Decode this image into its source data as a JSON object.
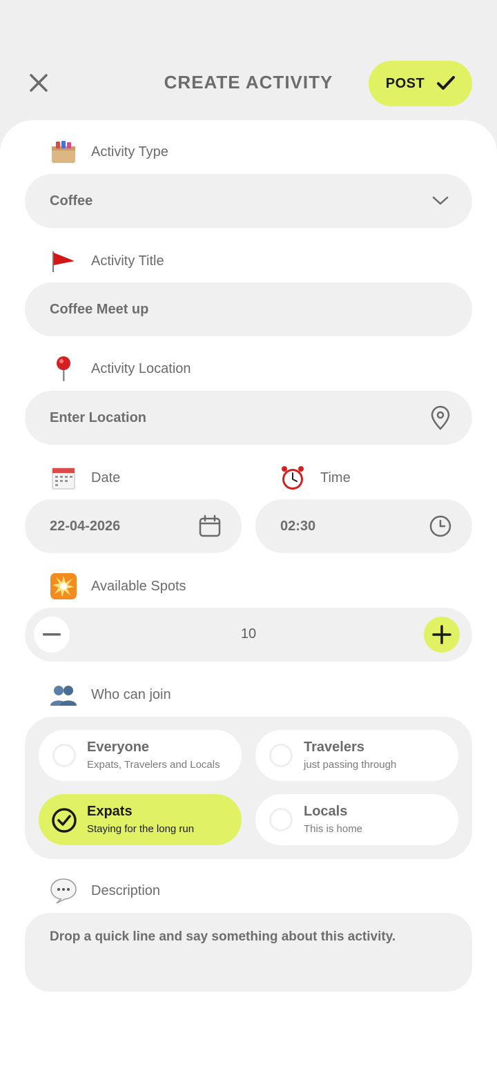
{
  "header": {
    "title": "CREATE ACTIVITY",
    "post_label": "POST",
    "accent_color": "#e0f264"
  },
  "activity_type": {
    "label": "Activity Type",
    "value": "Coffee",
    "icon": "card-file-box-emoji"
  },
  "activity_title": {
    "label": "Activity Title",
    "value": "Coffee Meet up",
    "icon": "red-flag-emoji"
  },
  "activity_location": {
    "label": "Activity Location",
    "placeholder": "Enter Location",
    "icon": "round-pushpin-emoji"
  },
  "date": {
    "label": "Date",
    "value": "22-04-2026",
    "icon": "spiral-calendar-emoji"
  },
  "time": {
    "label": "Time",
    "value": "02:30",
    "icon": "alarm-clock-emoji"
  },
  "spots": {
    "label": "Available Spots",
    "value": "10",
    "icon": "eight-pointed-star-emoji"
  },
  "who_can_join": {
    "label": "Who can join",
    "icon": "busts-in-silhouette-emoji",
    "options": [
      {
        "title": "Everyone",
        "subtitle": "Expats, Travelers and Locals",
        "selected": false
      },
      {
        "title": "Travelers",
        "subtitle": "just passing through",
        "selected": false
      },
      {
        "title": "Expats",
        "subtitle": "Staying for the long run",
        "selected": true
      },
      {
        "title": "Locals",
        "subtitle": "This is home",
        "selected": false
      }
    ]
  },
  "description": {
    "label": "Description",
    "placeholder": "Drop a quick line and say something about this activity.",
    "icon": "speech-balloon-emoji"
  }
}
